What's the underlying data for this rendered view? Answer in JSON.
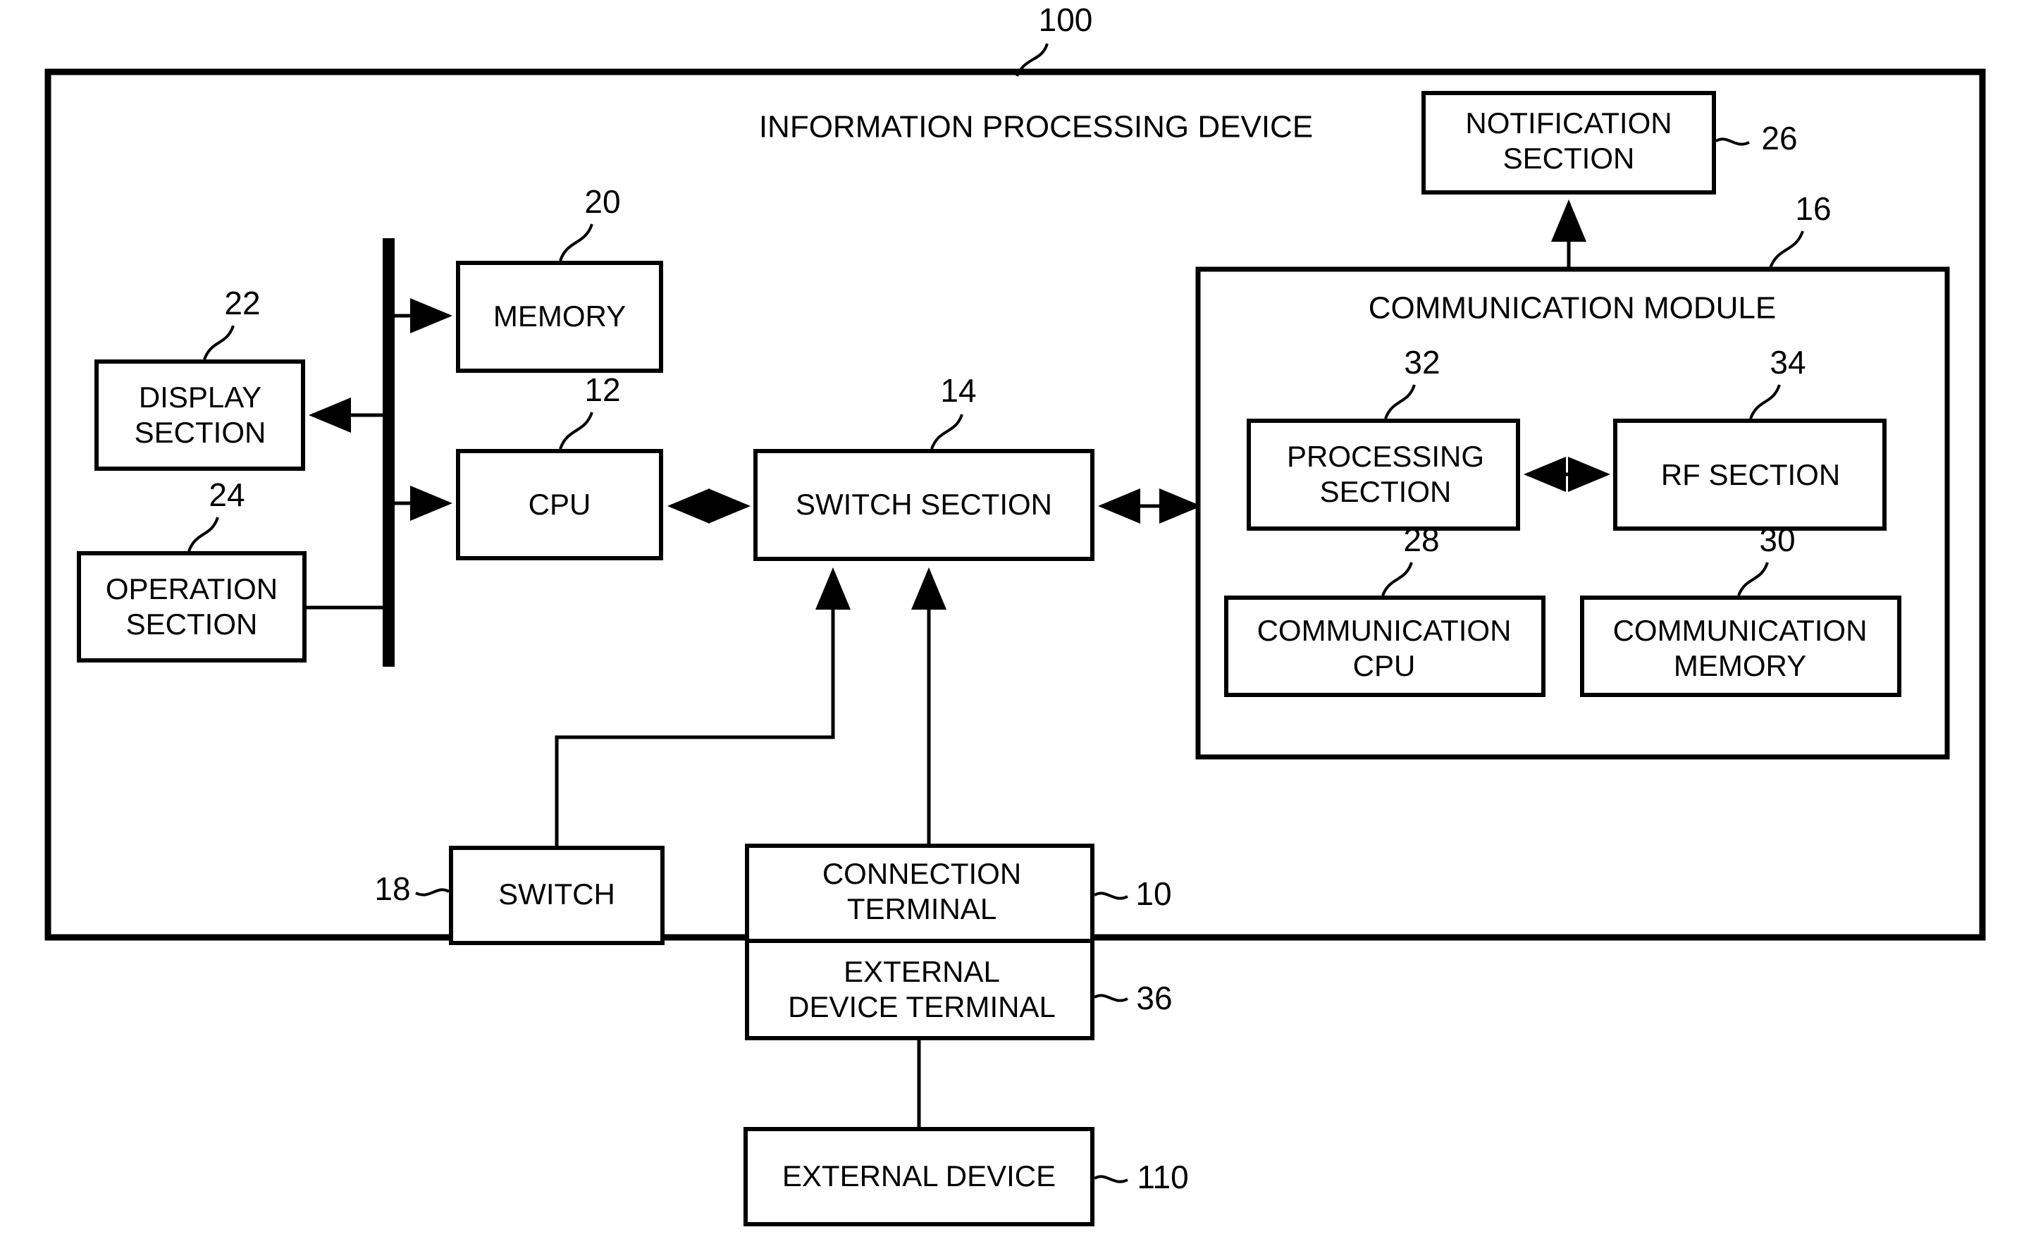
{
  "figure": {
    "type": "patent-block-diagram",
    "background_color": "#ffffff",
    "line_color": "#000000",
    "outer_frame": {
      "title": "INFORMATION PROCESSING DEVICE",
      "ref": "100"
    },
    "boxes": [
      {
        "id": "memory",
        "label": "MEMORY",
        "ref": "20"
      },
      {
        "id": "display-section",
        "label_line1": "DISPLAY",
        "label_line2": "SECTION",
        "ref": "22"
      },
      {
        "id": "operation-section",
        "label_line1": "OPERATION",
        "label_line2": "SECTION",
        "ref": "24"
      },
      {
        "id": "cpu",
        "label": "CPU",
        "ref": "12"
      },
      {
        "id": "switch-section",
        "label": "SWITCH SECTION",
        "ref": "14"
      },
      {
        "id": "notification-section",
        "label_line1": "NOTIFICATION",
        "label_line2": "SECTION",
        "ref": "26"
      },
      {
        "id": "communication-module",
        "label": "COMMUNICATION MODULE",
        "ref": "16"
      },
      {
        "id": "processing-section",
        "label_line1": "PROCESSING",
        "label_line2": "SECTION",
        "ref": "32"
      },
      {
        "id": "rf-section",
        "label": "RF SECTION",
        "ref": "34"
      },
      {
        "id": "communication-cpu",
        "label_line1": "COMMUNICATION",
        "label_line2": "CPU",
        "ref": "28"
      },
      {
        "id": "communication-memory",
        "label_line1": "COMMUNICATION",
        "label_line2": "MEMORY",
        "ref": "30"
      },
      {
        "id": "switch",
        "label": "SWITCH",
        "ref": "18"
      },
      {
        "id": "connection-terminal",
        "label_line1": "CONNECTION",
        "label_line2": "TERMINAL",
        "ref": "10"
      },
      {
        "id": "external-device-terminal",
        "label_line1": "EXTERNAL",
        "label_line2": "DEVICE TERMINAL",
        "ref": "36"
      },
      {
        "id": "external-device",
        "label": "EXTERNAL DEVICE",
        "ref": "110"
      }
    ],
    "labels": {
      "device_title": "INFORMATION PROCESSING DEVICE",
      "memory": "MEMORY",
      "display_1": "DISPLAY",
      "display_2": "SECTION",
      "operation_1": "OPERATION",
      "operation_2": "SECTION",
      "cpu": "CPU",
      "switch_section": "SWITCH SECTION",
      "notification_1": "NOTIFICATION",
      "notification_2": "SECTION",
      "communication_module": "COMMUNICATION MODULE",
      "processing_1": "PROCESSING",
      "processing_2": "SECTION",
      "rf_section": "RF SECTION",
      "comm_cpu_1": "COMMUNICATION",
      "comm_cpu_2": "CPU",
      "comm_mem_1": "COMMUNICATION",
      "comm_mem_2": "MEMORY",
      "switch": "SWITCH",
      "connection_1": "CONNECTION",
      "connection_2": "TERMINAL",
      "ext_term_1": "EXTERNAL",
      "ext_term_2": "DEVICE TERMINAL",
      "external_device": "EXTERNAL DEVICE"
    },
    "refs": {
      "r100": "100",
      "r20": "20",
      "r22": "22",
      "r24": "24",
      "r12": "12",
      "r14": "14",
      "r26": "26",
      "r16": "16",
      "r32": "32",
      "r34": "34",
      "r28": "28",
      "r30": "30",
      "r18": "18",
      "r10": "10",
      "r36": "36",
      "r110": "110"
    }
  }
}
